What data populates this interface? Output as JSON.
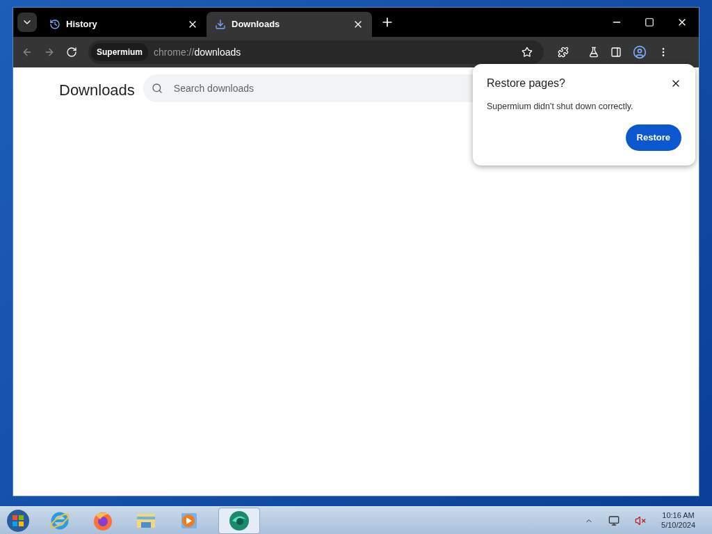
{
  "tabs": [
    {
      "title": "History",
      "kind": "history",
      "selected": false
    },
    {
      "title": "Downloads",
      "kind": "download",
      "selected": true
    }
  ],
  "toolbar": {
    "site_chip": "Supermium",
    "url_scheme": "chrome://",
    "url_path": "downloads"
  },
  "page": {
    "title": "Downloads",
    "search": {
      "placeholder": "Search downloads"
    }
  },
  "dialog": {
    "title": "Restore pages?",
    "message": "Supermium didn't shut down correctly.",
    "button": "Restore"
  },
  "taskbar": {
    "apps": [
      {
        "kind": "ie",
        "selected": false
      },
      {
        "kind": "firefox",
        "selected": false
      },
      {
        "kind": "explorer",
        "selected": false
      },
      {
        "kind": "media",
        "selected": false
      },
      {
        "kind": "supermium",
        "selected": true
      }
    ],
    "time": "10:16 AM",
    "date": "5/10/2024"
  }
}
